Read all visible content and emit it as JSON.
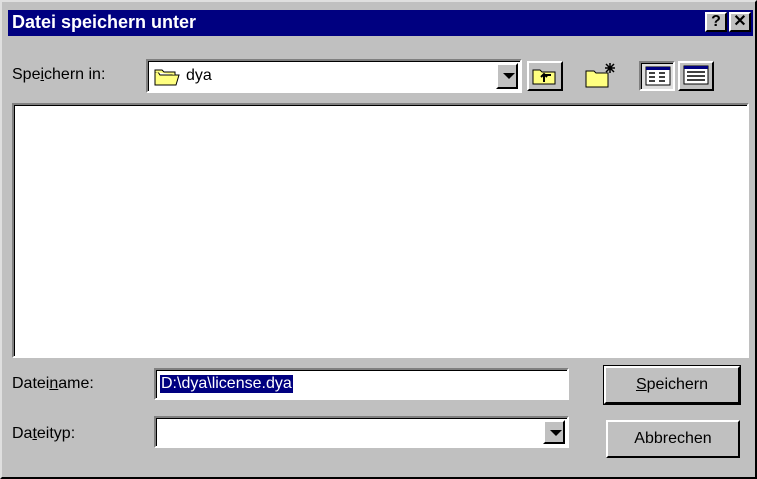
{
  "window": {
    "title": "Datei speichern unter",
    "help_label": "?",
    "close_label": "✕"
  },
  "location": {
    "label_pre": "Spe",
    "label_u": "i",
    "label_post": "chern in:",
    "current_folder": "dya",
    "folder_icon": "folder-icon"
  },
  "toolbar": {
    "up_icon": "up-one-level-icon",
    "new_folder_icon": "new-folder-icon",
    "list_icon": "list-view-icon",
    "details_icon": "details-view-icon"
  },
  "filename": {
    "label_pre": "Datei",
    "label_u": "n",
    "label_post": "ame:",
    "value": "D:\\dya\\license.dya"
  },
  "filetype": {
    "label_pre": "Da",
    "label_u": "t",
    "label_post": "eityp:",
    "value": ""
  },
  "buttons": {
    "save_u": "S",
    "save_rest": "peichern",
    "cancel": "Abbrechen"
  }
}
